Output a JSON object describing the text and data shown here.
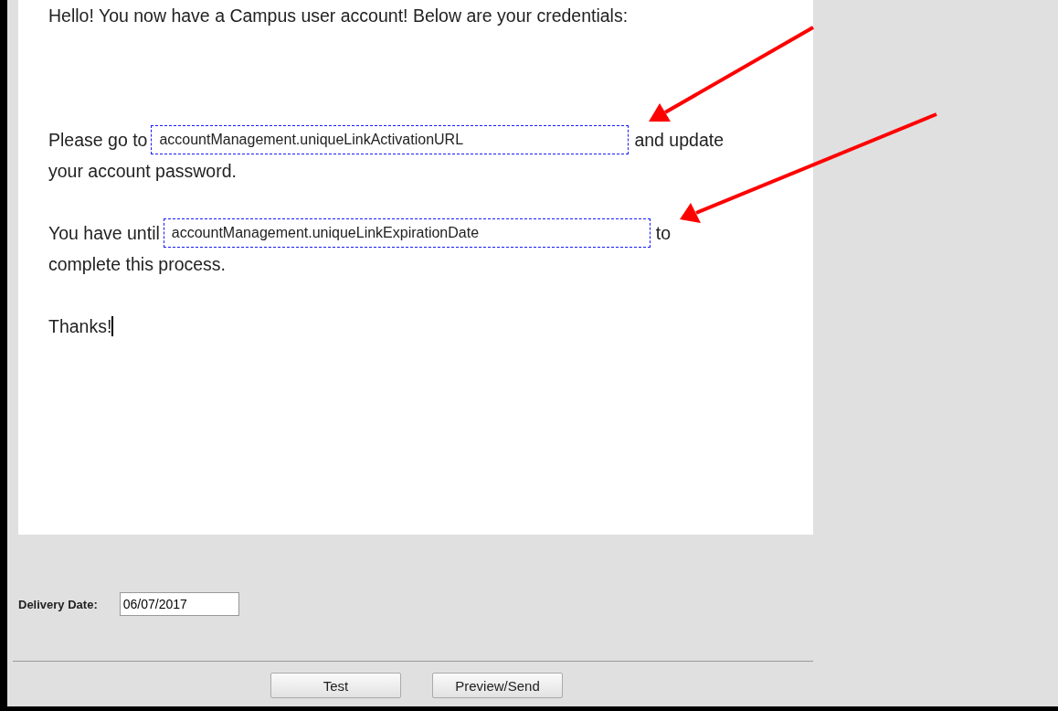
{
  "message": {
    "paragraphs": [
      {
        "caret": false,
        "lines": [
          [
            {
              "kind": "text",
              "text": "Hello! You now have a Campus user account! Below are your credentials:"
            }
          ]
        ]
      },
      {
        "caret": false,
        "lines": [
          [
            {
              "kind": "text",
              "text": "Please go to"
            },
            {
              "kind": "field",
              "text": "accountManagement.uniqueLinkActivationURL"
            },
            {
              "kind": "text",
              "text": "and update"
            }
          ],
          [
            {
              "kind": "text",
              "text": "your account password."
            }
          ]
        ]
      },
      {
        "caret": false,
        "lines": [
          [
            {
              "kind": "text",
              "text": "You have until"
            },
            {
              "kind": "field",
              "text": "accountManagement.uniqueLinkExpirationDate"
            },
            {
              "kind": "text",
              "text": "to"
            }
          ],
          [
            {
              "kind": "text",
              "text": "complete this process."
            }
          ]
        ]
      },
      {
        "caret": true,
        "lines": [
          [
            {
              "kind": "text",
              "text": "Thanks!"
            }
          ]
        ]
      }
    ]
  },
  "delivery_date": {
    "label": "Delivery Date:",
    "value": "06/07/2017"
  },
  "buttons": [
    "Test",
    "Preview/Send"
  ]
}
